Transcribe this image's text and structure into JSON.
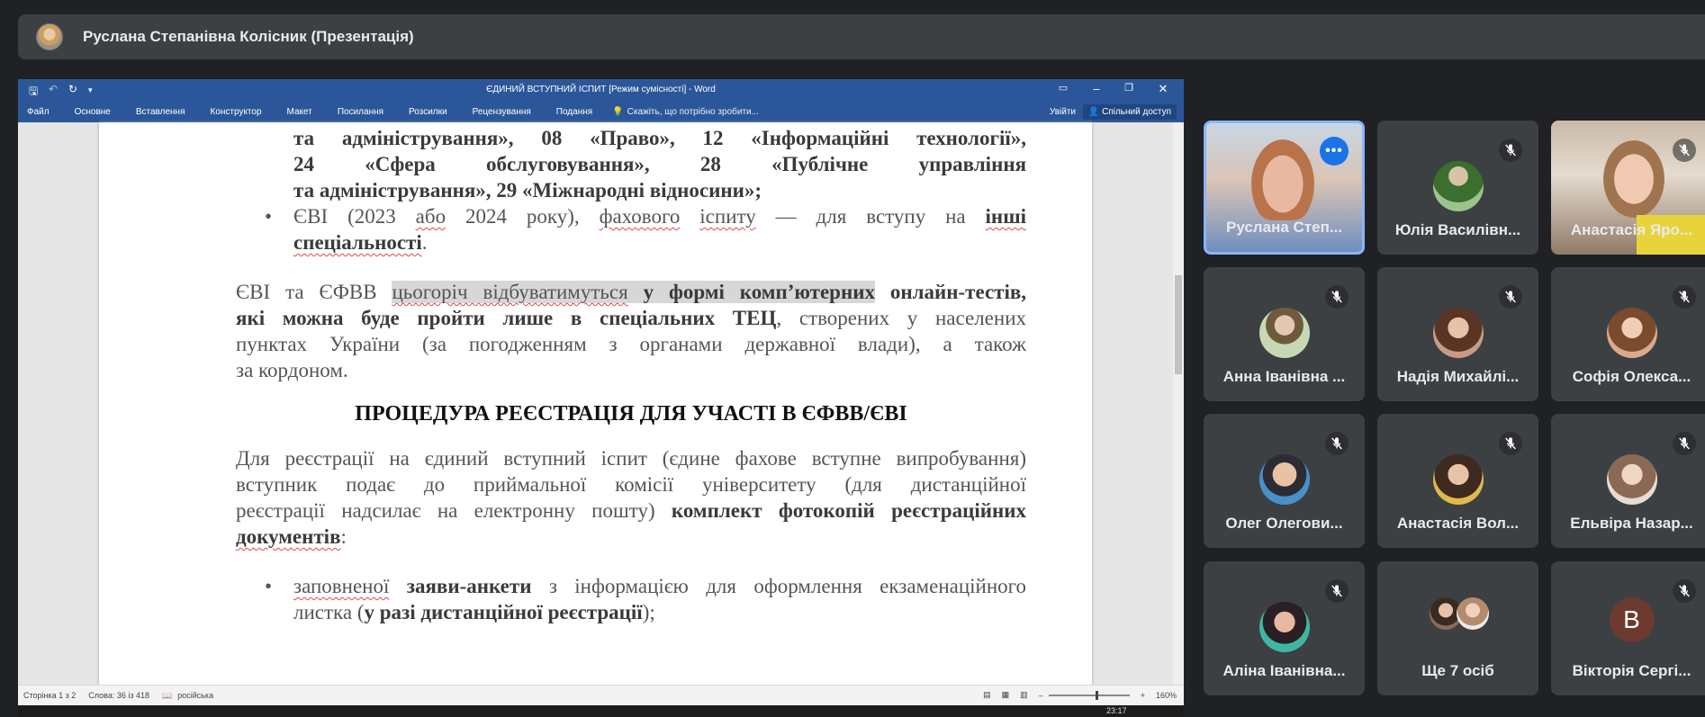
{
  "presenter": {
    "name": "Руслана Степанівна Колісник (Презентація)"
  },
  "word": {
    "title": "ЄДИНИЙ ВСТУПНИЙ ІСПИТ [Режим сумісності] - Word",
    "tabs": [
      "Файл",
      "Основне",
      "Вставлення",
      "Конструктор",
      "Макет",
      "Посилання",
      "Розсилки",
      "Рецензування",
      "Подання"
    ],
    "tell_me": "Скажіть, що потрібно зробити...",
    "sign_in": "Увійти",
    "share": "Спільний доступ",
    "status": {
      "page": "Сторінка 1 з 2",
      "words": "Слова: 36 із 418",
      "language": "російська",
      "zoom": "160%"
    }
  },
  "document": {
    "top_line1": [
      "та адміністрування»,",
      "08 «Право»,",
      "12 «Інформаційні",
      "технології»,"
    ],
    "top_line2": [
      "24 «Сфера",
      "обслуговування»,",
      "28 «Публічне",
      "управління"
    ],
    "top_line3": "та адміністрування», 29 «Міжнародні відносини»;",
    "bullet1_line1_a": "ЄВІ (2023",
    "bullet1_line1_b": "або",
    "bullet1_line1_c": "2024 року),",
    "bullet1_line1_d": "фахового",
    "bullet1_line1_e": "іспиту",
    "bullet1_line1_f": "— для вступу на",
    "bullet1_line1_g": "інші",
    "bullet1_line2": "спеціальності",
    "para1": {
      "l1_a": "ЄВІ та ЄФВВ",
      "l1_b": "цьогоріч відбуватимуться",
      "l1_c": "у формі комп’ютерних",
      "l1_d": "онлайн-тестів,",
      "l2_a": "які можна буде пройти лише в спеціальних ТЕЦ",
      "l2_b": ", створених у населених",
      "l3": "пунктах України (за погодженням з органами державної влади), а також",
      "l4": "за кордоном."
    },
    "heading": "ПРОЦЕДУРА РЕЄСТРАЦІЯ ДЛЯ УЧАСТІ В ЄФВВ/ЄВІ",
    "para2": {
      "l1": "Для реєстрації на єдиний вступний іспит (єдине фахове вступне випробування)",
      "l2": "вступник подає до приймальної комісії університету (для дистанційної",
      "l3_a": "реєстрації надсилає на електронну пошту)",
      "l3_b": "комплект фотокопій реєстраційних",
      "l4": "документів"
    },
    "bullet2": {
      "l1_a": "заповненої",
      "l1_b": "заяви-анкети",
      "l1_c": "з інформацією для оформлення екзаменаційного",
      "l2_a": "листка (",
      "l2_b": "у разі дистанційної реєстрації",
      "l2_c": ");"
    }
  },
  "taskbar": {
    "time": "23:17"
  },
  "participants": [
    {
      "name": "Руслана Степ...",
      "speaking": true,
      "muted": false
    },
    {
      "name": "Юлія Василівн...",
      "muted": true
    },
    {
      "name": "Анастасія Яро...",
      "muted": true
    },
    {
      "name": "Анна Іванівна ...",
      "muted": true
    },
    {
      "name": "Надія Михайлі...",
      "muted": true
    },
    {
      "name": "Софія Олекса...",
      "muted": true
    },
    {
      "name": "Олег Олегови...",
      "muted": true
    },
    {
      "name": "Анастасія Вол...",
      "muted": true
    },
    {
      "name": "Ельвіра Назар...",
      "muted": true
    },
    {
      "name": "Аліна Іванівна...",
      "muted": true
    },
    {
      "name": "Ще 7 осіб"
    },
    {
      "name": "Вікторія Сергі...",
      "muted": true,
      "initial": "В",
      "avatar_color": "#6d3a30"
    }
  ],
  "icons": {
    "mic_off": "mic-off-icon",
    "more": "more-options-icon"
  }
}
